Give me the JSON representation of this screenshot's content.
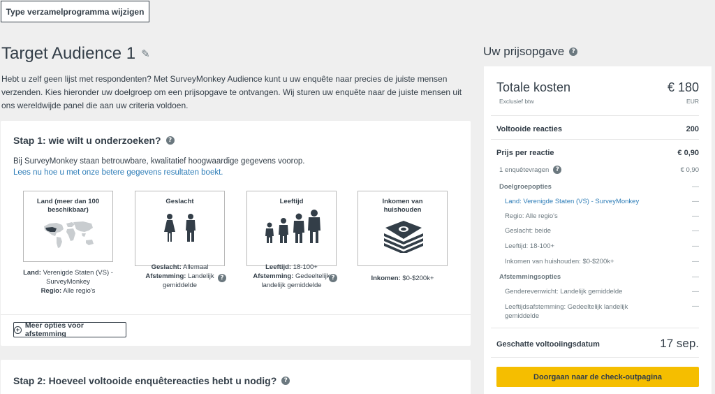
{
  "top_button": {
    "label": "Type verzamelprogramma wijzigen"
  },
  "audience": {
    "title": "Target Audience 1",
    "intro": "Hebt u zelf geen lijst met respondenten? Met SurveyMonkey Audience kunt u uw enquête naar precies de juiste mensen verzenden. Kies hieronder uw doelgroep om een prijsopgave te ontvangen. Wij sturen uw enquête naar de juiste mensen uit ons wereldwijde panel die aan uw criteria voldoen."
  },
  "step1": {
    "title": "Stap 1: wie wilt u onderzoeken?",
    "description": "Bij SurveyMonkey staan betrouwbare, kwalitatief hoogwaardige gegevens voorop.",
    "link": "Lees nu hoe u met onze betere gegevens resultaten boekt.",
    "criteria": [
      {
        "title": "Land (meer dan 100 beschikbaar)",
        "icon": "world-map-icon",
        "caption": [
          {
            "label": "Land:",
            "value": "Verenigde Staten (VS) - SurveyMonkey"
          },
          {
            "label": "Regio:",
            "value": "Alle regio's"
          }
        ]
      },
      {
        "title": "Geslacht",
        "icon": "gender-icon",
        "caption": [
          {
            "label": "Geslacht:",
            "value": "Allemaal"
          },
          {
            "label": "Afstemming:",
            "value": "Landelijk gemiddelde"
          }
        ]
      },
      {
        "title": "Leeftijd",
        "icon": "age-group-icon",
        "caption": [
          {
            "label": "Leeftijd:",
            "value": "18-100+"
          },
          {
            "label": "Afstemming:",
            "value": "Gedeeltelijk landelijk gemiddelde"
          }
        ]
      },
      {
        "title": "Inkomen van huishouden",
        "icon": "money-stack-icon",
        "caption": [
          {
            "label": "Inkomen:",
            "value": "$0-$200k+"
          }
        ]
      }
    ],
    "more_options": "Meer opties voor afstemming"
  },
  "step2": {
    "title": "Stap 2: Hoeveel voltooide enquêtereacties hebt u nodig?"
  },
  "quote": {
    "heading": "Uw prijsopgave",
    "total_label": "Totale kosten",
    "total_value": "€ 180",
    "total_note": "Exclusief btw",
    "currency": "EUR",
    "completed_label": "Voltooide reacties",
    "completed_value": "200",
    "price_label": "Prijs per reactie",
    "price_value": "€ 0,90",
    "questions_label": "1 enquêtevragen",
    "questions_value": "€ 0,90",
    "target_options_title": "Doelgroepopties",
    "target_options": [
      {
        "label": "Land: Verenigde Staten (VS) - SurveyMonkey",
        "value": "—",
        "link": true
      },
      {
        "label": "Regio: Alle regio's",
        "value": "—"
      },
      {
        "label": "Geslacht: beide",
        "value": "—"
      },
      {
        "label": "Leeftijd: 18-100+",
        "value": "—"
      },
      {
        "label": "Inkomen van huishouden: $0-$200k+",
        "value": "—"
      }
    ],
    "balance_title": "Afstemmingsopties",
    "balance_options": [
      {
        "label": "Genderevenwicht: Landelijk gemiddelde",
        "value": "—"
      },
      {
        "label": "Leeftijdsafstemming: Gedeeltelijk landelijk gemiddelde",
        "value": "—"
      }
    ],
    "eta_label": "Geschatte voltooiingsdatum",
    "eta_value": "17 sep.",
    "checkout": "Doorgaan naar de check-outpagina"
  },
  "icons": {
    "edit": "pencil-icon",
    "help": "question-icon",
    "add": "plus-circle-icon"
  }
}
